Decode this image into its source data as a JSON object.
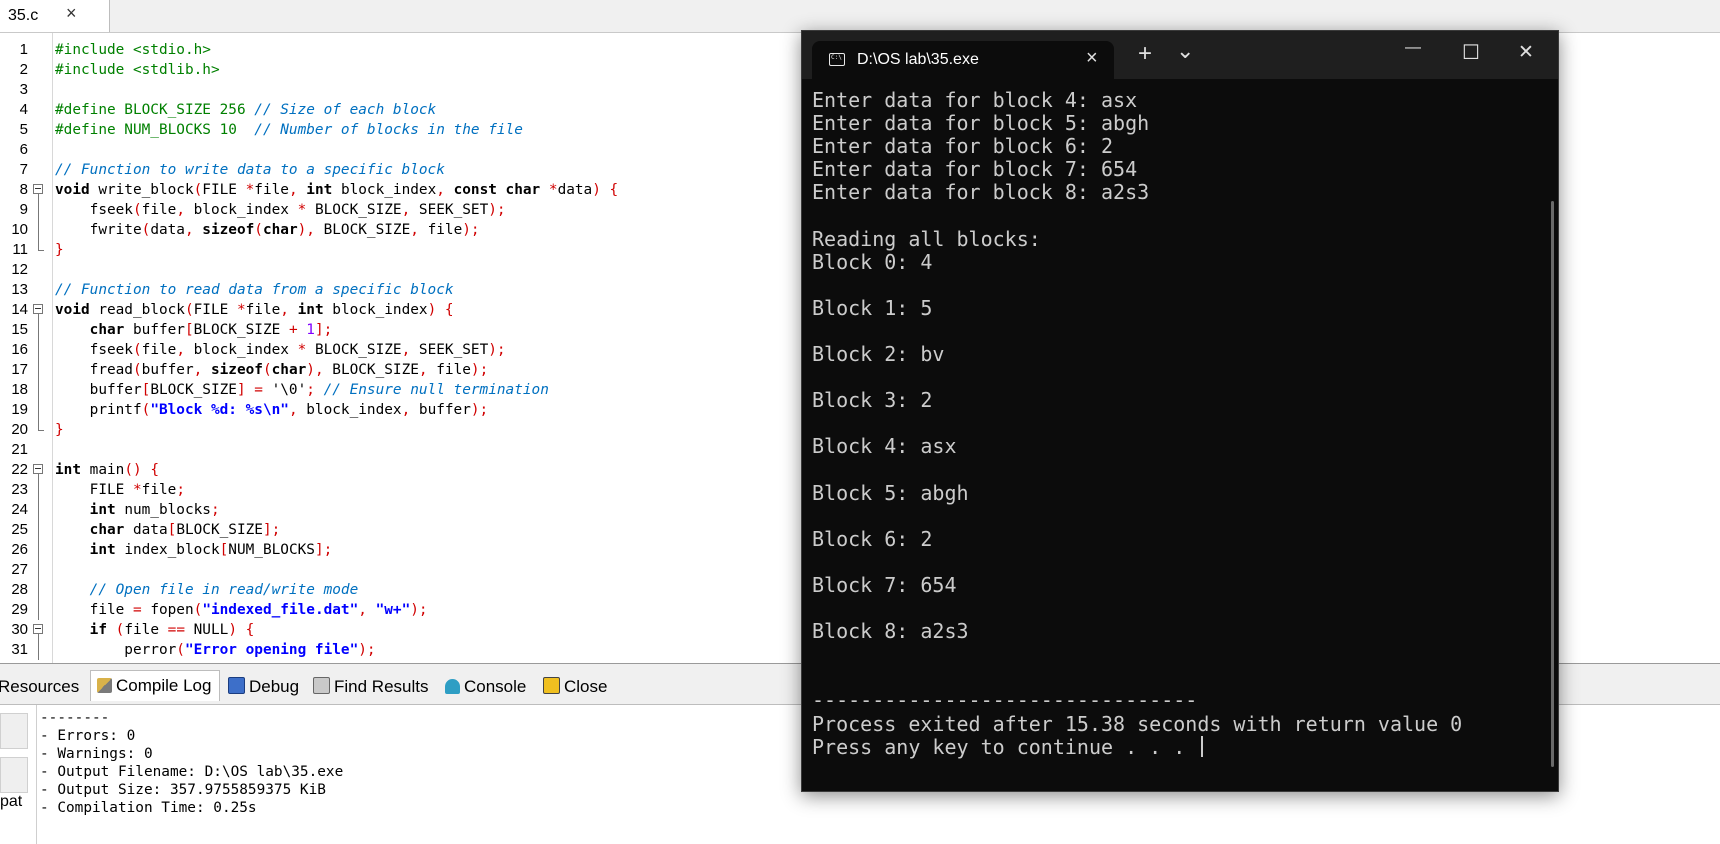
{
  "editor": {
    "tab_name": "35.c",
    "tab_close": "×",
    "lines": [
      {
        "n": "1",
        "fold": "",
        "t": [
          [
            "pp",
            "#include <stdio.h>"
          ]
        ]
      },
      {
        "n": "2",
        "fold": "",
        "t": [
          [
            "pp",
            "#include <stdlib.h>"
          ]
        ]
      },
      {
        "n": "3",
        "fold": "",
        "t": []
      },
      {
        "n": "4",
        "fold": "",
        "t": [
          [
            "pp",
            "#define BLOCK_SIZE 256 "
          ],
          [
            "cm",
            "// Size of each block"
          ]
        ]
      },
      {
        "n": "5",
        "fold": "",
        "t": [
          [
            "pp",
            "#define NUM_BLOCKS 10  "
          ],
          [
            "cm",
            "// Number of blocks in the file"
          ]
        ]
      },
      {
        "n": "6",
        "fold": "",
        "t": []
      },
      {
        "n": "7",
        "fold": "",
        "t": [
          [
            "cm",
            "// Function to write data to a specific block"
          ]
        ]
      },
      {
        "n": "8",
        "fold": "open",
        "t": [
          [
            "kw",
            "void"
          ],
          [
            "pl",
            " write_block"
          ],
          [
            "op",
            "("
          ],
          [
            "pl",
            "FILE "
          ],
          [
            "op",
            "*"
          ],
          [
            "pl",
            "file"
          ],
          [
            "op",
            ", "
          ],
          [
            "kw",
            "int"
          ],
          [
            "pl",
            " block_index"
          ],
          [
            "op",
            ", "
          ],
          [
            "kw",
            "const char"
          ],
          [
            "pl",
            " "
          ],
          [
            "op",
            "*"
          ],
          [
            "pl",
            "data"
          ],
          [
            "op",
            ") {"
          ]
        ]
      },
      {
        "n": "9",
        "fold": "mid",
        "t": [
          [
            "pl",
            "    fseek"
          ],
          [
            "op",
            "("
          ],
          [
            "pl",
            "file"
          ],
          [
            "op",
            ", "
          ],
          [
            "pl",
            "block_index "
          ],
          [
            "op",
            "*"
          ],
          [
            "pl",
            " BLOCK_SIZE"
          ],
          [
            "op",
            ", "
          ],
          [
            "pl",
            "SEEK_SET"
          ],
          [
            "op",
            ");"
          ]
        ]
      },
      {
        "n": "10",
        "fold": "mid",
        "t": [
          [
            "pl",
            "    fwrite"
          ],
          [
            "op",
            "("
          ],
          [
            "pl",
            "data"
          ],
          [
            "op",
            ", "
          ],
          [
            "kw",
            "sizeof"
          ],
          [
            "op",
            "("
          ],
          [
            "kw",
            "char"
          ],
          [
            "op",
            "), "
          ],
          [
            "pl",
            "BLOCK_SIZE"
          ],
          [
            "op",
            ", "
          ],
          [
            "pl",
            "file"
          ],
          [
            "op",
            ");"
          ]
        ]
      },
      {
        "n": "11",
        "fold": "end",
        "t": [
          [
            "op",
            "}"
          ]
        ]
      },
      {
        "n": "12",
        "fold": "",
        "t": []
      },
      {
        "n": "13",
        "fold": "",
        "t": [
          [
            "cm",
            "// Function to read data from a specific block"
          ]
        ]
      },
      {
        "n": "14",
        "fold": "open",
        "t": [
          [
            "kw",
            "void"
          ],
          [
            "pl",
            " read_block"
          ],
          [
            "op",
            "("
          ],
          [
            "pl",
            "FILE "
          ],
          [
            "op",
            "*"
          ],
          [
            "pl",
            "file"
          ],
          [
            "op",
            ", "
          ],
          [
            "kw",
            "int"
          ],
          [
            "pl",
            " block_index"
          ],
          [
            "op",
            ") {"
          ]
        ]
      },
      {
        "n": "15",
        "fold": "mid",
        "t": [
          [
            "pl",
            "    "
          ],
          [
            "kw",
            "char"
          ],
          [
            "pl",
            " buffer"
          ],
          [
            "op",
            "["
          ],
          [
            "pl",
            "BLOCK_SIZE "
          ],
          [
            "op",
            "+ "
          ],
          [
            "num",
            "1"
          ],
          [
            "op",
            "];"
          ]
        ]
      },
      {
        "n": "16",
        "fold": "mid",
        "t": [
          [
            "pl",
            "    fseek"
          ],
          [
            "op",
            "("
          ],
          [
            "pl",
            "file"
          ],
          [
            "op",
            ", "
          ],
          [
            "pl",
            "block_index "
          ],
          [
            "op",
            "*"
          ],
          [
            "pl",
            " BLOCK_SIZE"
          ],
          [
            "op",
            ", "
          ],
          [
            "pl",
            "SEEK_SET"
          ],
          [
            "op",
            ");"
          ]
        ]
      },
      {
        "n": "17",
        "fold": "mid",
        "t": [
          [
            "pl",
            "    fread"
          ],
          [
            "op",
            "("
          ],
          [
            "pl",
            "buffer"
          ],
          [
            "op",
            ", "
          ],
          [
            "kw",
            "sizeof"
          ],
          [
            "op",
            "("
          ],
          [
            "kw",
            "char"
          ],
          [
            "op",
            "), "
          ],
          [
            "pl",
            "BLOCK_SIZE"
          ],
          [
            "op",
            ", "
          ],
          [
            "pl",
            "file"
          ],
          [
            "op",
            ");"
          ]
        ]
      },
      {
        "n": "18",
        "fold": "mid",
        "t": [
          [
            "pl",
            "    buffer"
          ],
          [
            "op",
            "["
          ],
          [
            "pl",
            "BLOCK_SIZE"
          ],
          [
            "op",
            "] = "
          ],
          [
            "pl",
            "'\\0'"
          ],
          [
            "op",
            "; "
          ],
          [
            "cm",
            "// Ensure null termination"
          ]
        ]
      },
      {
        "n": "19",
        "fold": "mid",
        "t": [
          [
            "pl",
            "    printf"
          ],
          [
            "op",
            "("
          ],
          [
            "str",
            "\"Block %d: %s\\n\""
          ],
          [
            "op",
            ", "
          ],
          [
            "pl",
            "block_index"
          ],
          [
            "op",
            ", "
          ],
          [
            "pl",
            "buffer"
          ],
          [
            "op",
            ");"
          ]
        ]
      },
      {
        "n": "20",
        "fold": "end",
        "t": [
          [
            "op",
            "}"
          ]
        ]
      },
      {
        "n": "21",
        "fold": "",
        "t": []
      },
      {
        "n": "22",
        "fold": "open",
        "t": [
          [
            "kw",
            "int"
          ],
          [
            "pl",
            " main"
          ],
          [
            "op",
            "() {"
          ]
        ]
      },
      {
        "n": "23",
        "fold": "mid",
        "t": [
          [
            "pl",
            "    FILE "
          ],
          [
            "op",
            "*"
          ],
          [
            "pl",
            "file"
          ],
          [
            "op",
            ";"
          ]
        ]
      },
      {
        "n": "24",
        "fold": "mid",
        "t": [
          [
            "pl",
            "    "
          ],
          [
            "kw",
            "int"
          ],
          [
            "pl",
            " num_blocks"
          ],
          [
            "op",
            ";"
          ]
        ]
      },
      {
        "n": "25",
        "fold": "mid",
        "t": [
          [
            "pl",
            "    "
          ],
          [
            "kw",
            "char"
          ],
          [
            "pl",
            " data"
          ],
          [
            "op",
            "["
          ],
          [
            "pl",
            "BLOCK_SIZE"
          ],
          [
            "op",
            "];"
          ]
        ]
      },
      {
        "n": "26",
        "fold": "mid",
        "t": [
          [
            "pl",
            "    "
          ],
          [
            "kw",
            "int"
          ],
          [
            "pl",
            " index_block"
          ],
          [
            "op",
            "["
          ],
          [
            "pl",
            "NUM_BLOCKS"
          ],
          [
            "op",
            "];"
          ]
        ]
      },
      {
        "n": "27",
        "fold": "mid",
        "t": []
      },
      {
        "n": "28",
        "fold": "mid",
        "t": [
          [
            "pl",
            "    "
          ],
          [
            "cm",
            "// Open file in read/write mode"
          ]
        ]
      },
      {
        "n": "29",
        "fold": "mid",
        "t": [
          [
            "pl",
            "    file "
          ],
          [
            "op",
            "="
          ],
          [
            "pl",
            " fopen"
          ],
          [
            "op",
            "("
          ],
          [
            "str",
            "\"indexed_file.dat\""
          ],
          [
            "op",
            ", "
          ],
          [
            "str",
            "\"w+\""
          ],
          [
            "op",
            ");"
          ]
        ]
      },
      {
        "n": "30",
        "fold": "open",
        "t": [
          [
            "pl",
            "    "
          ],
          [
            "kw",
            "if"
          ],
          [
            "pl",
            " "
          ],
          [
            "op",
            "("
          ],
          [
            "pl",
            "file "
          ],
          [
            "op",
            "=="
          ],
          [
            "pl",
            " NULL"
          ],
          [
            "op",
            ") {"
          ]
        ]
      },
      {
        "n": "31",
        "fold": "mid",
        "t": [
          [
            "pl",
            "        perror"
          ],
          [
            "op",
            "("
          ],
          [
            "str",
            "\"Error opening file\""
          ],
          [
            "op",
            ");"
          ]
        ]
      }
    ]
  },
  "bottom_tabs": [
    {
      "label": "Resources",
      "icon": "resources-icon",
      "active": false
    },
    {
      "label": "Compile Log",
      "icon": "compile-log-icon",
      "active": true
    },
    {
      "label": "Debug",
      "icon": "debug-icon",
      "active": false
    },
    {
      "label": "Find Results",
      "icon": "find-results-icon",
      "active": false
    },
    {
      "label": "Console",
      "icon": "console-icon",
      "active": false
    },
    {
      "label": "Close",
      "icon": "save-close-icon",
      "active": false
    }
  ],
  "compile_log": {
    "side_label": "pat",
    "lines": [
      "--------",
      "- Errors: 0",
      "- Warnings: 0",
      "- Output Filename: D:\\OS lab\\35.exe",
      "- Output Size: 357.9755859375 KiB",
      "- Compilation Time: 0.25s"
    ]
  },
  "console": {
    "tab_title": "D:\\OS lab\\35.exe",
    "tab_close": "×",
    "new_tab": "+",
    "dropdown": "⌄",
    "minimize": "—",
    "maximize": "☐",
    "close": "✕",
    "output": [
      "Enter data for block 4: asx",
      "Enter data for block 5: abgh",
      "Enter data for block 6: 2",
      "Enter data for block 7: 654",
      "Enter data for block 8: a2s3",
      "",
      "Reading all blocks:",
      "Block 0: 4",
      "",
      "Block 1: 5",
      "",
      "Block 2: bv",
      "",
      "Block 3: 2",
      "",
      "Block 4: asx",
      "",
      "Block 5: abgh",
      "",
      "Block 6: 2",
      "",
      "Block 7: 654",
      "",
      "Block 8: a2s3",
      "",
      "",
      "--------------------------------",
      "Process exited after 15.38 seconds with return value 0",
      "Press any key to continue . . . "
    ]
  },
  "colors": {
    "preprocessor": "#008000",
    "comment": "#0070c0",
    "operator": "#d00000",
    "string": "#0000ff",
    "number": "#8000ff",
    "console_bg": "#0c0c0c",
    "console_text": "#cccccc",
    "titlebar": "#1f1f1f"
  }
}
